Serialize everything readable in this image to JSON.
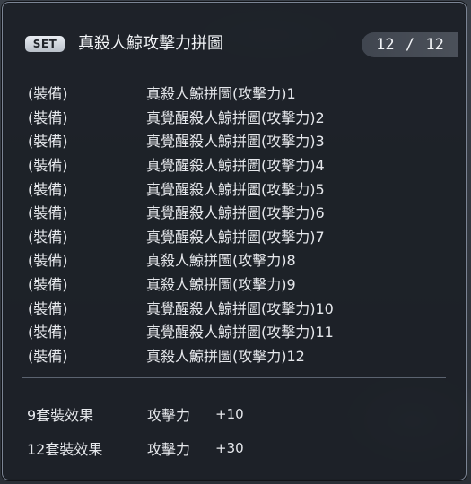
{
  "set": {
    "badge": "SET",
    "title": "真殺人鯨攻擊力拼圖",
    "count": "12 / 12"
  },
  "items": [
    {
      "slot": "(裝備)",
      "name": "真殺人鯨拼圖(攻擊力)1"
    },
    {
      "slot": "(裝備)",
      "name": "真覺醒殺人鯨拼圖(攻擊力)2"
    },
    {
      "slot": "(裝備)",
      "name": "真覺醒殺人鯨拼圖(攻擊力)3"
    },
    {
      "slot": "(裝備)",
      "name": "真覺醒殺人鯨拼圖(攻擊力)4"
    },
    {
      "slot": "(裝備)",
      "name": "真覺醒殺人鯨拼圖(攻擊力)5"
    },
    {
      "slot": "(裝備)",
      "name": "真覺醒殺人鯨拼圖(攻擊力)6"
    },
    {
      "slot": "(裝備)",
      "name": "真覺醒殺人鯨拼圖(攻擊力)7"
    },
    {
      "slot": "(裝備)",
      "name": "真殺人鯨拼圖(攻擊力)8"
    },
    {
      "slot": "(裝備)",
      "name": "真殺人鯨拼圖(攻擊力)9"
    },
    {
      "slot": "(裝備)",
      "name": "真覺醒殺人鯨拼圖(攻擊力)10"
    },
    {
      "slot": "(裝備)",
      "name": "真覺醒殺人鯨拼圖(攻擊力)11"
    },
    {
      "slot": "(裝備)",
      "name": "真殺人鯨拼圖(攻擊力)12"
    }
  ],
  "effects": [
    {
      "label": "9套裝效果",
      "stat": "攻擊力",
      "value": "+10"
    },
    {
      "label": "12套裝效果",
      "stat": "攻擊力",
      "value": "+30"
    }
  ],
  "colors": {
    "panel_bg": "#1c2027",
    "panel_border": "#7b8494",
    "text": "#e6e8ec",
    "badge_bg": "#d4d9e0"
  }
}
